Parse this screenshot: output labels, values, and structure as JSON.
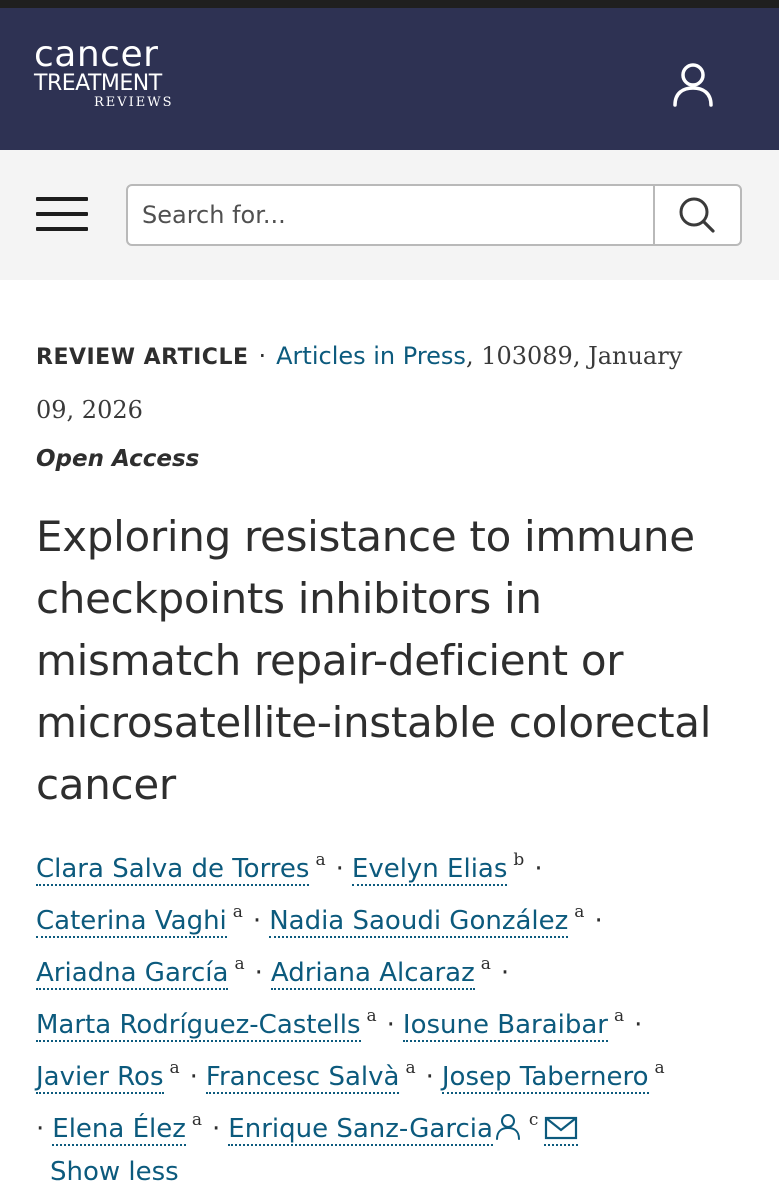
{
  "header": {
    "logo_line1": "cancer",
    "logo_line2": "TREATMENT",
    "logo_line3": "REVIEWS",
    "account_icon": "person-icon"
  },
  "search": {
    "placeholder": "Search for...",
    "menu_icon": "hamburger-icon",
    "search_icon": "magnifier-icon"
  },
  "article": {
    "type": "REVIEW ARTICLE",
    "separator": "·",
    "journal_link": "Articles in Press",
    "details_line1": ", 103089, January",
    "details_line2": "09, 2026",
    "access": "Open Access",
    "title": "Exploring resistance to immune checkpoints inhibitors in mismatch repair-deficient or microsatellite-instable colorectal cancer"
  },
  "authors": [
    {
      "name": "Clara Salva de Torres",
      "aff": "a"
    },
    {
      "name": "Evelyn Elias",
      "aff": "b"
    },
    {
      "name": "Caterina Vaghi",
      "aff": "a"
    },
    {
      "name": "Nadia Saoudi González",
      "aff": "a"
    },
    {
      "name": "Ariadna García",
      "aff": "a"
    },
    {
      "name": "Adriana Alcaraz",
      "aff": "a"
    },
    {
      "name": "Marta Rodríguez-Castells",
      "aff": "a"
    },
    {
      "name": "Iosune Baraibar",
      "aff": "a"
    },
    {
      "name": "Javier Ros",
      "aff": "a"
    },
    {
      "name": "Francesc Salvà",
      "aff": "a"
    },
    {
      "name": "Josep Tabernero",
      "aff": "a"
    },
    {
      "name": "Elena Élez",
      "aff": "a"
    },
    {
      "name": "Enrique Sanz-Garcia",
      "aff": "c"
    }
  ],
  "author_separator": "·",
  "show_less": "Show less",
  "colors": {
    "header_bg": "#2e3253",
    "link": "#0c5a7d",
    "search_bar_bg": "#f4f4f4"
  }
}
